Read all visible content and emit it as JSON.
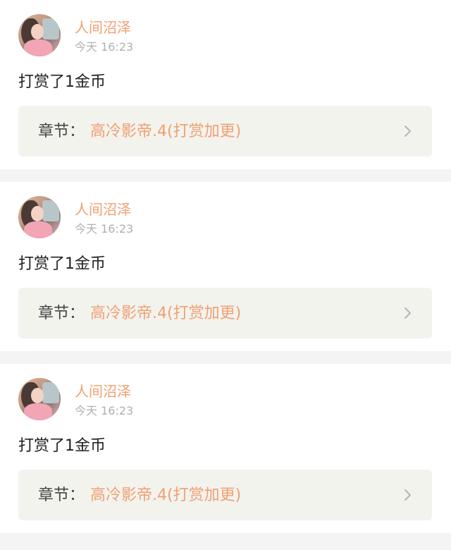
{
  "colors": {
    "accent": "#f0a071",
    "text_primary": "#222222",
    "text_secondary": "#b0b0b0",
    "chapter_bg": "#f3f3ee",
    "page_bg": "#f4f4f4"
  },
  "feed": {
    "items": [
      {
        "username": "人间沼泽",
        "time": "今天 16:23",
        "message": "打赏了1金币",
        "chapter_label": "章节：",
        "chapter_title": "高冷影帝.4(打赏加更)",
        "icon": "chevron-right-icon"
      },
      {
        "username": "人间沼泽",
        "time": "今天 16:23",
        "message": "打赏了1金币",
        "chapter_label": "章节：",
        "chapter_title": "高冷影帝.4(打赏加更)",
        "icon": "chevron-right-icon"
      },
      {
        "username": "人间沼泽",
        "time": "今天 16:23",
        "message": "打赏了1金币",
        "chapter_label": "章节：",
        "chapter_title": "高冷影帝.4(打赏加更)",
        "icon": "chevron-right-icon"
      }
    ]
  }
}
